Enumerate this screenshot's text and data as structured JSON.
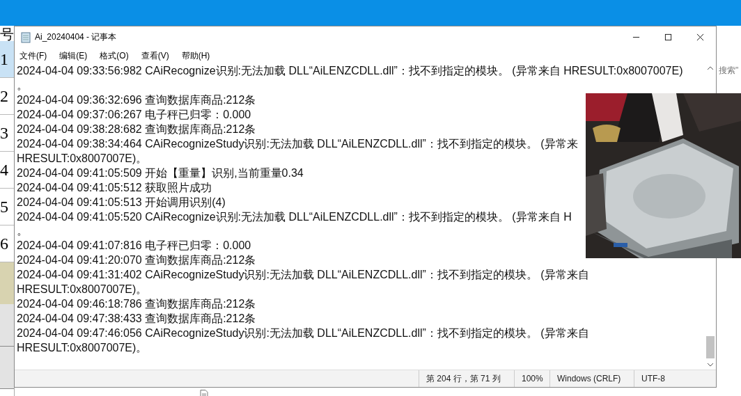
{
  "background_app": {
    "row_header": "号",
    "rows": [
      {
        "label": "1",
        "selected": true
      },
      {
        "label": "2",
        "selected": false
      },
      {
        "label": "3",
        "selected": false
      },
      {
        "label": "4",
        "selected": false
      },
      {
        "label": "5",
        "selected": false
      },
      {
        "label": "6",
        "selected": false
      }
    ],
    "search_hint": "搜索\""
  },
  "notepad": {
    "title": "Ai_20240404 - 记事本",
    "menu": [
      "文件(F)",
      "编辑(E)",
      "格式(O)",
      "查看(V)",
      "帮助(H)"
    ],
    "lines": [
      "2024-04-04 09:33:56:982 CAiRecognize识别:无法加载 DLL“AiLENZCDLL.dll”：找不到指定的模块。 (异常来自 HRESULT:0x8007007E)",
      "。",
      "2024-04-04 09:36:32:696 查询数据库商品:212条",
      "2024-04-04 09:37:06:267 电子秤已归零：0.000",
      "2024-04-04 09:38:28:682 查询数据库商品:212条",
      "2024-04-04 09:38:34:464 CAiRecognizeStudy识别:无法加载 DLL“AiLENZCDLL.dll”：找不到指定的模块。 (异常来",
      "HRESULT:0x8007007E)。",
      "2024-04-04 09:41:05:509 开始【重量】识别,当前重量0.34",
      "2024-04-04 09:41:05:512 获取照片成功",
      "2024-04-04 09:41:05:513 开始调用识别(4)",
      "2024-04-04 09:41:05:520 CAiRecognize识别:无法加载 DLL“AiLENZCDLL.dll”：找不到指定的模块。 (异常来自 H",
      "。",
      "2024-04-04 09:41:07:816 电子秤已归零：0.000",
      "2024-04-04 09:41:20:070 查询数据库商品:212条",
      "2024-04-04 09:41:31:402 CAiRecognizeStudy识别:无法加载 DLL“AiLENZCDLL.dll”：找不到指定的模块。 (异常来自",
      "HRESULT:0x8007007E)。",
      "2024-04-04 09:46:18:786 查询数据库商品:212条",
      "2024-04-04 09:47:38:433 查询数据库商品:212条",
      "2024-04-04 09:47:46:056 CAiRecognizeStudy识别:无法加载 DLL“AiLENZCDLL.dll”：找不到指定的模块。 (异常来自",
      "HRESULT:0x8007007E)。"
    ],
    "status_bar": {
      "position": "第 204 行，第 71 列",
      "zoom": "100%",
      "line_ending": "Windows (CRLF)",
      "encoding": "UTF-8"
    }
  }
}
